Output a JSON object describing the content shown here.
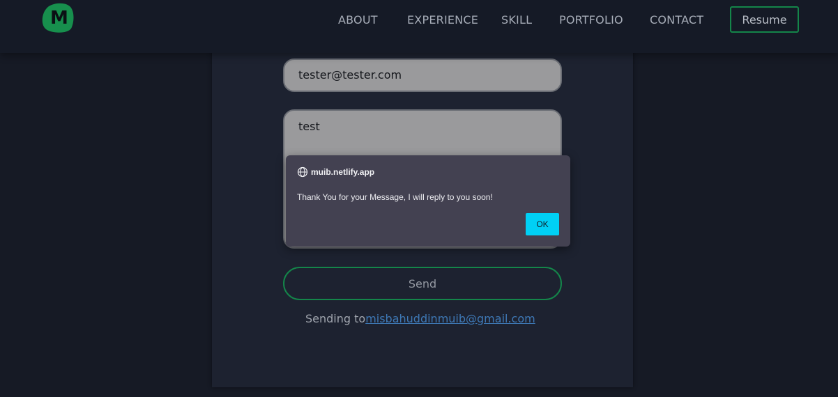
{
  "navbar": {
    "logo_letter": "M",
    "links": [
      "ABOUT",
      "EXPERIENCE",
      "SKILL",
      "PORTFOLIO",
      "CONTACT"
    ],
    "resume_label": "Resume"
  },
  "form": {
    "email_value": "tester@tester.com",
    "message_value": "test",
    "send_label": "Send",
    "sending_prefix": "Sending to",
    "sending_email": "misbahuddinmuib@gmail.com"
  },
  "dialog": {
    "site": "muib.netlify.app",
    "message": "Thank You for your Message, I will reply to you soon!",
    "ok_label": "OK"
  },
  "colors": {
    "accent_green": "#14864a",
    "ok_button": "#00d0f5",
    "link_blue": "#3e78b5",
    "background": "#161a25"
  },
  "icons": {
    "dialog_site_icon": "globe-icon"
  }
}
